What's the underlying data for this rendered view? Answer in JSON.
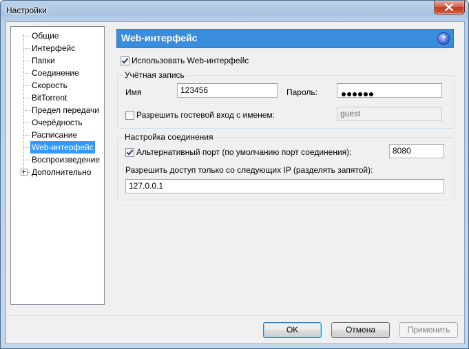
{
  "window": {
    "title": "Настройки"
  },
  "tree": {
    "items": [
      {
        "label": "Общие"
      },
      {
        "label": "Интерфейс"
      },
      {
        "label": "Папки"
      },
      {
        "label": "Соединение"
      },
      {
        "label": "Скорость"
      },
      {
        "label": "BitTorrent"
      },
      {
        "label": "Предел передачи"
      },
      {
        "label": "Очерёдность"
      },
      {
        "label": "Расписание"
      },
      {
        "label": "Web-интерфейс",
        "selected": true
      },
      {
        "label": "Воспроизведение"
      },
      {
        "label": "Дополнительно",
        "expandable": true
      }
    ]
  },
  "panel": {
    "title": "Web-интерфейс",
    "help_glyph": "?",
    "enable_web_ui": {
      "label": "Использовать Web-интерфейс",
      "checked": true
    },
    "account": {
      "group_label": "Учётная запись",
      "username_label": "Имя",
      "username_value": "123456",
      "password_label": "Пароль:",
      "password_mask_length": 6,
      "guest_checkbox_label": "Разрешить гостевой вход с именем:",
      "guest_checked": false,
      "guest_name_value": "guest"
    },
    "connection": {
      "group_label": "Настройка соединения",
      "alt_port_label": "Альтернативный порт (по умолчанию порт соединения):",
      "alt_port_checked": true,
      "alt_port_value": "8080",
      "restrict_ip_label": "Разрешить доступ только со следующих IP (разделять запятой):",
      "restrict_ip_value": "127.0.0.1"
    }
  },
  "buttons": {
    "ok": "OK",
    "cancel": "Отмена",
    "apply": "Применить"
  },
  "colors": {
    "header_bar": "#3a8ddd",
    "selection": "#3399ff",
    "close_button": "#c23c22"
  }
}
